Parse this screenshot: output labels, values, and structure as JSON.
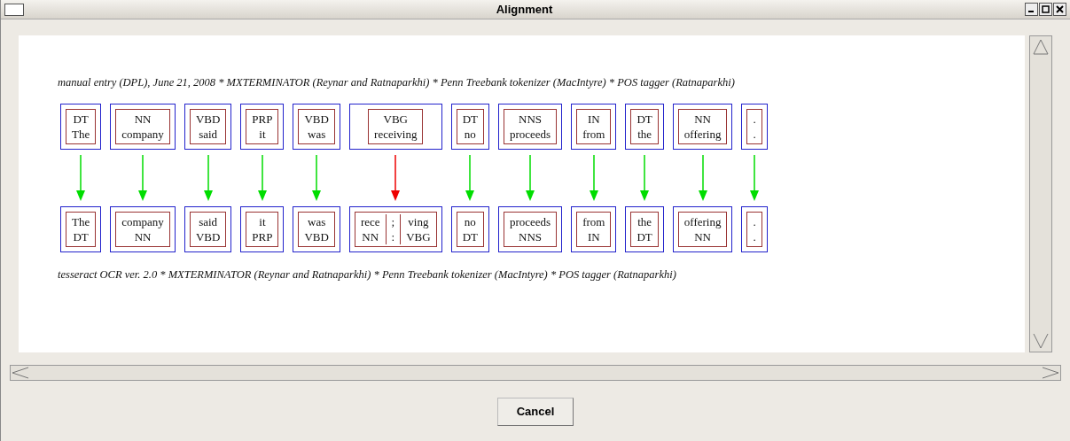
{
  "window": {
    "title": "Alignment"
  },
  "source_caption": "manual entry (DPL), June 21, 2008 * MXTERMINATOR (Reynar and Ratnaparkhi) * Penn Treebank tokenizer (MacIntyre) * POS tagger (Ratnaparkhi)",
  "alignments": [
    {
      "top": {
        "tag": "DT",
        "word": "The"
      },
      "color": "#00dd00",
      "bottom": [
        {
          "word": "The",
          "tag": "DT"
        }
      ]
    },
    {
      "top": {
        "tag": "NN",
        "word": "company"
      },
      "color": "#00dd00",
      "bottom": [
        {
          "word": "company",
          "tag": "NN"
        }
      ]
    },
    {
      "top": {
        "tag": "VBD",
        "word": "said"
      },
      "color": "#00dd00",
      "bottom": [
        {
          "word": "said",
          "tag": "VBD"
        }
      ]
    },
    {
      "top": {
        "tag": "PRP",
        "word": "it"
      },
      "color": "#00dd00",
      "bottom": [
        {
          "word": "it",
          "tag": "PRP"
        }
      ]
    },
    {
      "top": {
        "tag": "VBD",
        "word": "was"
      },
      "color": "#00dd00",
      "bottom": [
        {
          "word": "was",
          "tag": "VBD"
        }
      ]
    },
    {
      "top": {
        "tag": "VBG",
        "word": "receiving"
      },
      "color": "#ee0000",
      "bottom": [
        {
          "word": "rece",
          "tag": "NN"
        },
        {
          "word": ";",
          "tag": ":"
        },
        {
          "word": "ving",
          "tag": "VBG"
        }
      ]
    },
    {
      "top": {
        "tag": "DT",
        "word": "no"
      },
      "color": "#00dd00",
      "bottom": [
        {
          "word": "no",
          "tag": "DT"
        }
      ]
    },
    {
      "top": {
        "tag": "NNS",
        "word": "proceeds"
      },
      "color": "#00dd00",
      "bottom": [
        {
          "word": "proceeds",
          "tag": "NNS"
        }
      ]
    },
    {
      "top": {
        "tag": "IN",
        "word": "from"
      },
      "color": "#00dd00",
      "bottom": [
        {
          "word": "from",
          "tag": "IN"
        }
      ]
    },
    {
      "top": {
        "tag": "DT",
        "word": "the"
      },
      "color": "#00dd00",
      "bottom": [
        {
          "word": "the",
          "tag": "DT"
        }
      ]
    },
    {
      "top": {
        "tag": "NN",
        "word": "offering"
      },
      "color": "#00dd00",
      "bottom": [
        {
          "word": "offering",
          "tag": "NN"
        }
      ]
    },
    {
      "top": {
        "tag": ".",
        "word": "."
      },
      "color": "#00dd00",
      "bottom": [
        {
          "word": ".",
          "tag": "."
        }
      ]
    }
  ],
  "target_caption": "tesseract OCR ver. 2.0 * MXTERMINATOR (Reynar and Ratnaparkhi) * Penn Treebank tokenizer (MacIntyre) * POS tagger (Ratnaparkhi)",
  "buttons": [
    "Cancel"
  ]
}
